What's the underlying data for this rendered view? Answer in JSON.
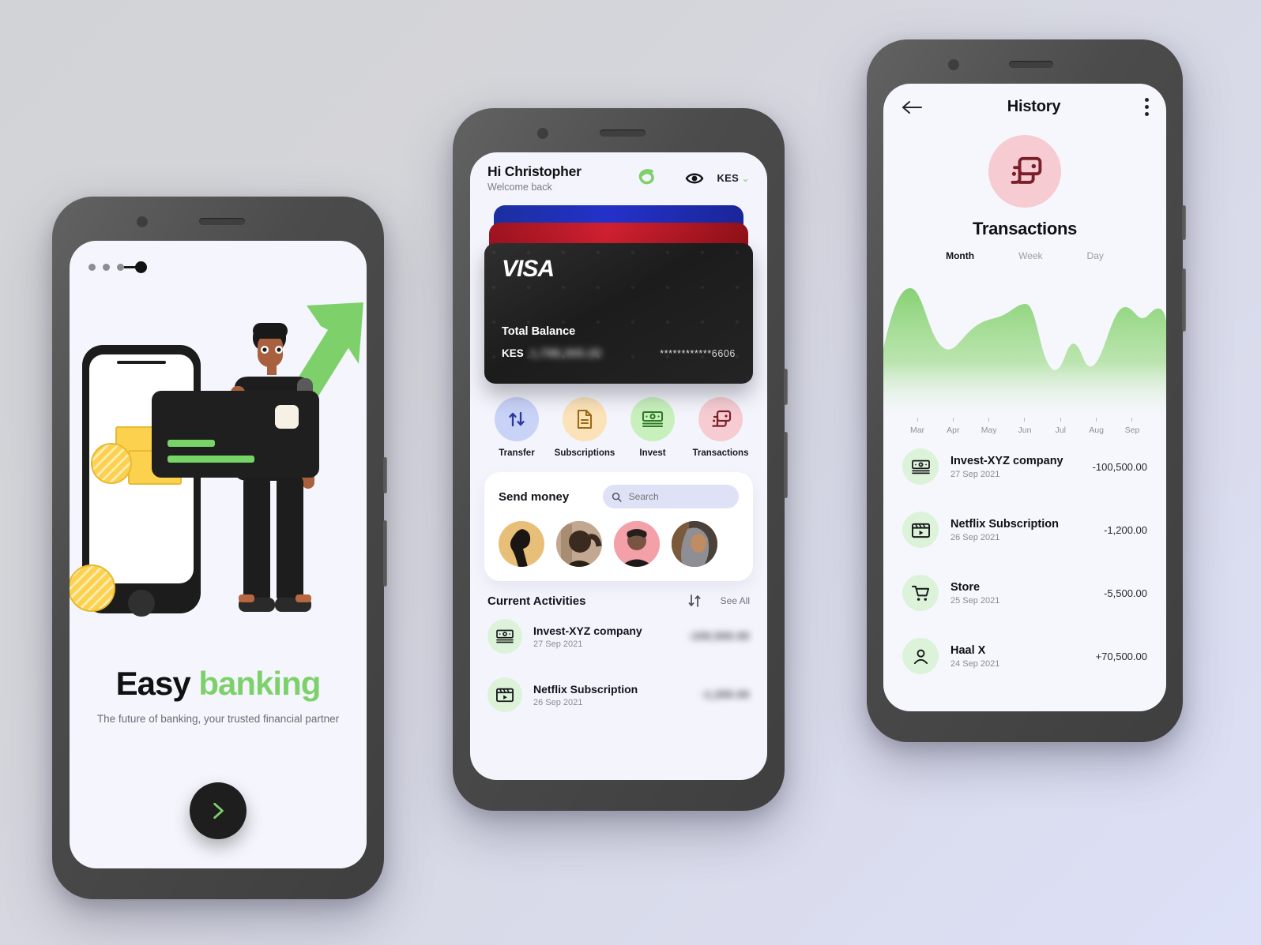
{
  "theme": {
    "green": "#7ed16a",
    "dark": "#1e1e1e",
    "bg_start": "#d2d3d6",
    "bg_end": "#dde0f7",
    "frame": "#4b4b4b"
  },
  "onboarding": {
    "page_indicator": {
      "total": 4,
      "current": 4
    },
    "title_black": "Easy",
    "title_green": "banking",
    "subtitle": "The future of banking, your trusted financial partner",
    "next_label": "›"
  },
  "home": {
    "greeting": "Hi Christopher",
    "welcome": "Welcome back",
    "currency": "KES",
    "currency_chevron": "⌄",
    "card": {
      "brand": "VISA",
      "balance_label": "Total Balance",
      "currency": "KES",
      "balance_value": "1,798,305.20",
      "masked_number": "************6606"
    },
    "actions": [
      {
        "label": "Transfer",
        "icon": "transfer-arrows-icon",
        "bg": "#c9d2f7",
        "fg": "#2a3a9c"
      },
      {
        "label": "Subscriptions",
        "icon": "document-icon",
        "bg": "#fbe2b8",
        "fg": "#9a6a14"
      },
      {
        "label": "Invest",
        "icon": "banknote-icon",
        "bg": "#c8f0bd",
        "fg": "#2f7a25"
      },
      {
        "label": "Transactions",
        "icon": "transactions-cards-icon",
        "bg": "#f6ccd2",
        "fg": "#7a1f2a"
      }
    ],
    "send_money": {
      "title": "Send money",
      "search_placeholder": "Search",
      "contacts": [
        {
          "name": "contact-1",
          "bg": "#e8bf78"
        },
        {
          "name": "contact-2",
          "bg": "#c2a890"
        },
        {
          "name": "contact-3",
          "bg": "#f4a0a8"
        },
        {
          "name": "contact-4",
          "bg": "#6b6258"
        }
      ]
    },
    "current_activities": {
      "title": "Current Activities",
      "sort_icon": "sort-updown-icon",
      "see_all": "See All",
      "rows": [
        {
          "name": "Invest-XYZ company",
          "date": "27 Sep 2021",
          "amount": "-100,500.00",
          "icon": "banknote-icon",
          "blurred": true
        },
        {
          "name": "Netflix Subscription",
          "date": "26 Sep 2021",
          "amount": "-1,200.00",
          "icon": "clapperboard-icon",
          "blurred": true
        }
      ]
    }
  },
  "history": {
    "back_icon": "arrow-left-icon",
    "title": "History",
    "menu_icon": "more-vertical-icon",
    "hero_icon": "transactions-cards-icon",
    "hero_title": "Transactions",
    "segments": [
      {
        "label": "Month",
        "active": true
      },
      {
        "label": "Week",
        "active": false
      },
      {
        "label": "Day",
        "active": false
      }
    ],
    "transactions": [
      {
        "name": "Invest-XYZ company",
        "date": "27 Sep 2021",
        "amount": "-100,500.00",
        "icon": "banknote-icon"
      },
      {
        "name": "Netflix Subscription",
        "date": "26 Sep 2021",
        "amount": "-1,200.00",
        "icon": "clapperboard-icon"
      },
      {
        "name": "Store",
        "date": "25 Sep 2021",
        "amount": "-5,500.00",
        "icon": "cart-icon"
      },
      {
        "name": "Haal X",
        "date": "24 Sep 2021",
        "amount": "+70,500.00",
        "icon": "person-icon"
      }
    ]
  },
  "chart_data": {
    "type": "area",
    "title": "Transactions",
    "xlabel": "",
    "ylabel": "",
    "categories": [
      "Mar",
      "Apr",
      "May",
      "Jun",
      "Jul",
      "Aug",
      "Sep"
    ],
    "x": [
      0,
      4,
      8,
      14,
      20,
      26,
      32,
      38,
      44,
      50,
      56,
      62,
      68,
      74,
      80,
      86,
      92,
      100
    ],
    "values": [
      62,
      86,
      80,
      46,
      30,
      44,
      58,
      64,
      70,
      40,
      16,
      22,
      45,
      28,
      62,
      78,
      72,
      64
    ],
    "series": [
      {
        "name": "Transactions",
        "values": [
          62,
          86,
          80,
          46,
          30,
          44,
          58,
          64,
          70,
          40,
          16,
          22,
          45,
          28,
          62,
          78,
          72,
          64
        ]
      }
    ],
    "ylim": [
      0,
      100
    ],
    "grid": false,
    "legend": "none",
    "fill_color": "#8bd47a",
    "fill_gradient_to": "rgba(139,212,122,0)"
  }
}
